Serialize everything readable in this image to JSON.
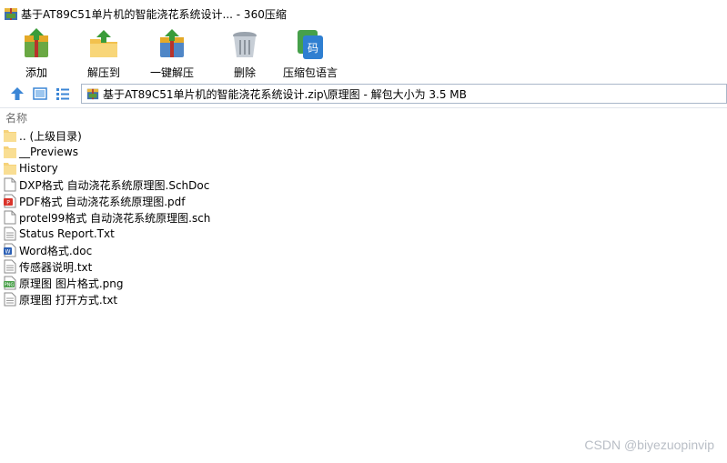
{
  "window": {
    "title": "基于AT89C51单片机的智能浇花系统设计... - 360压缩",
    "app_icon": "archive-icon"
  },
  "toolbar": {
    "items": [
      {
        "label": "添加",
        "icon": "add-icon"
      },
      {
        "label": "解压到",
        "icon": "extract-to-icon"
      },
      {
        "label": "一键解压",
        "icon": "one-click-extract-icon"
      },
      {
        "label": "删除",
        "icon": "delete-icon"
      },
      {
        "label": "压缩包语言",
        "icon": "archive-language-icon"
      }
    ]
  },
  "nav": {
    "up_icon": "up-arrow-icon",
    "view_icon": "thumbnail-view-icon",
    "list_icon": "list-view-icon",
    "address": "基于AT89C51单片机的智能浇花系统设计.zip\\原理图 - 解包大小为 3.5 MB"
  },
  "columns": {
    "name": "名称"
  },
  "files": [
    {
      "name": ".. (上级目录)",
      "type": "folder"
    },
    {
      "name": "__Previews",
      "type": "folder"
    },
    {
      "name": "History",
      "type": "folder"
    },
    {
      "name": "DXP格式 自动浇花系统原理图.SchDoc",
      "type": "file"
    },
    {
      "name": "PDF格式 自动浇花系统原理图.pdf",
      "type": "pdf"
    },
    {
      "name": "protel99格式 自动浇花系统原理图.sch",
      "type": "file"
    },
    {
      "name": "Status Report.Txt",
      "type": "text"
    },
    {
      "name": "Word格式.doc",
      "type": "word"
    },
    {
      "name": "传感器说明.txt",
      "type": "text"
    },
    {
      "name": "原理图  图片格式.png",
      "type": "png"
    },
    {
      "name": "原理图 打开方式.txt",
      "type": "text"
    }
  ],
  "watermark": "CSDN @biyezuopinvip",
  "colors": {
    "folder": "#f6d27a",
    "pdf": "#d9342b",
    "word": "#2b5fb4",
    "png": "#4aa04a",
    "accent": "#2f7fd1"
  }
}
